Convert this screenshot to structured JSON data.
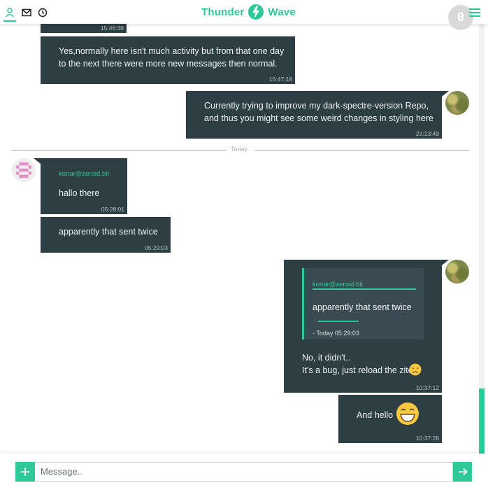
{
  "header": {
    "logo_left": "Thunder",
    "logo_right": "Wave",
    "notification_count": "0",
    "nav_icons": [
      "user-icon",
      "mail-icon",
      "clock-icon"
    ],
    "menu_icon": "hamburger-menu-icon"
  },
  "colors": {
    "accent": "#2fc899",
    "bubble": "#2e3e45",
    "quote": "#3a4a52"
  },
  "messages": [
    {
      "text": "",
      "time": "15:46:36"
    },
    {
      "text": "Yes,normally here isn't much activity but from that one day\nto the next there were more new messages then normal.",
      "time": "15:47:18"
    },
    {
      "text": "Currently trying to improve my dark-spectre-version Repo,\nand thus you might see some weird changes in styling here",
      "time": "23:23:49"
    }
  ],
  "divider": {
    "label": "Today"
  },
  "messages_today": [
    {
      "sender": "konar@zeroid.bit",
      "text": "hallo there",
      "time": "05:28:01"
    },
    {
      "text": "apparently that sent twice",
      "time": "05:29:03"
    },
    {
      "quote": {
        "sender": "konar@zeroid.bit",
        "text": "apparently that sent twice",
        "meta": "- Today 05:29:03"
      },
      "line1": "No, it didn't..",
      "line2": "It's a bug, just reload the zite",
      "emoji": "disappointed-face-emoji",
      "time": "10:37:12"
    },
    {
      "text": "And hello",
      "emoji": "grinning-face-emoji",
      "time": "10:37:28"
    }
  ],
  "composer": {
    "placeholder": "Message..",
    "add_icon": "plus-icon",
    "send_icon": "arrow-right-icon"
  }
}
